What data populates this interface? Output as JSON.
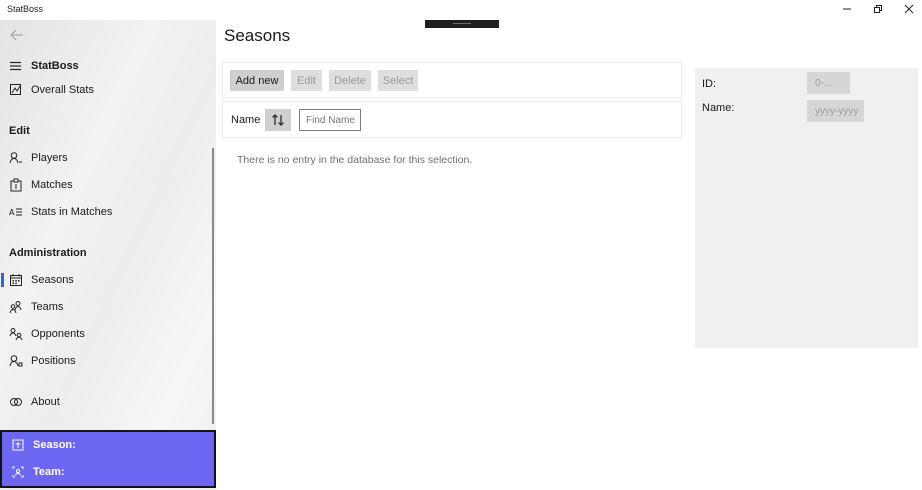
{
  "app": {
    "title": "StatBoss"
  },
  "window": {
    "minimize_icon": "minimize-icon",
    "restore_icon": "restore-icon",
    "close_icon": "close-icon"
  },
  "sidebar": {
    "back_icon": "back-arrow-icon",
    "menu": {
      "label": "StatBoss",
      "icon": "hamburger-icon"
    },
    "overall": {
      "label": "Overall Stats",
      "icon": "overall-stats-icon"
    },
    "sections": {
      "edit": "Edit",
      "administration": "Administration"
    },
    "items": {
      "players": {
        "label": "Players",
        "icon": "player-icon"
      },
      "matches": {
        "label": "Matches",
        "icon": "clipboard-icon"
      },
      "stats_in_matches": {
        "label": "Stats in Matches",
        "icon": "list-icon"
      },
      "seasons": {
        "label": "Seasons",
        "icon": "calendar-icon",
        "selected": true
      },
      "teams": {
        "label": "Teams",
        "icon": "team-icon"
      },
      "opponents": {
        "label": "Opponents",
        "icon": "opponents-icon"
      },
      "positions": {
        "label": "Positions",
        "icon": "position-icon"
      },
      "about": {
        "label": "About",
        "icon": "about-icon"
      }
    },
    "info": {
      "season_label": "Season:",
      "team_label": "Team:"
    },
    "accent": "#6d66f0",
    "selected_color": "#2e6bd1"
  },
  "main": {
    "title": "Seasons",
    "toolbar": {
      "add_new": "Add new",
      "edit": "Edit",
      "delete": "Delete",
      "select": "Select"
    },
    "filter": {
      "label": "Name",
      "sort_icon": "sort-icon",
      "find_placeholder": "Find Name"
    },
    "empty_message": "There is no entry in the database for this selection."
  },
  "detail": {
    "id_label": "ID:",
    "id_value": "0-...",
    "name_label": "Name:",
    "name_placeholder": "yyyy-yyyy"
  }
}
